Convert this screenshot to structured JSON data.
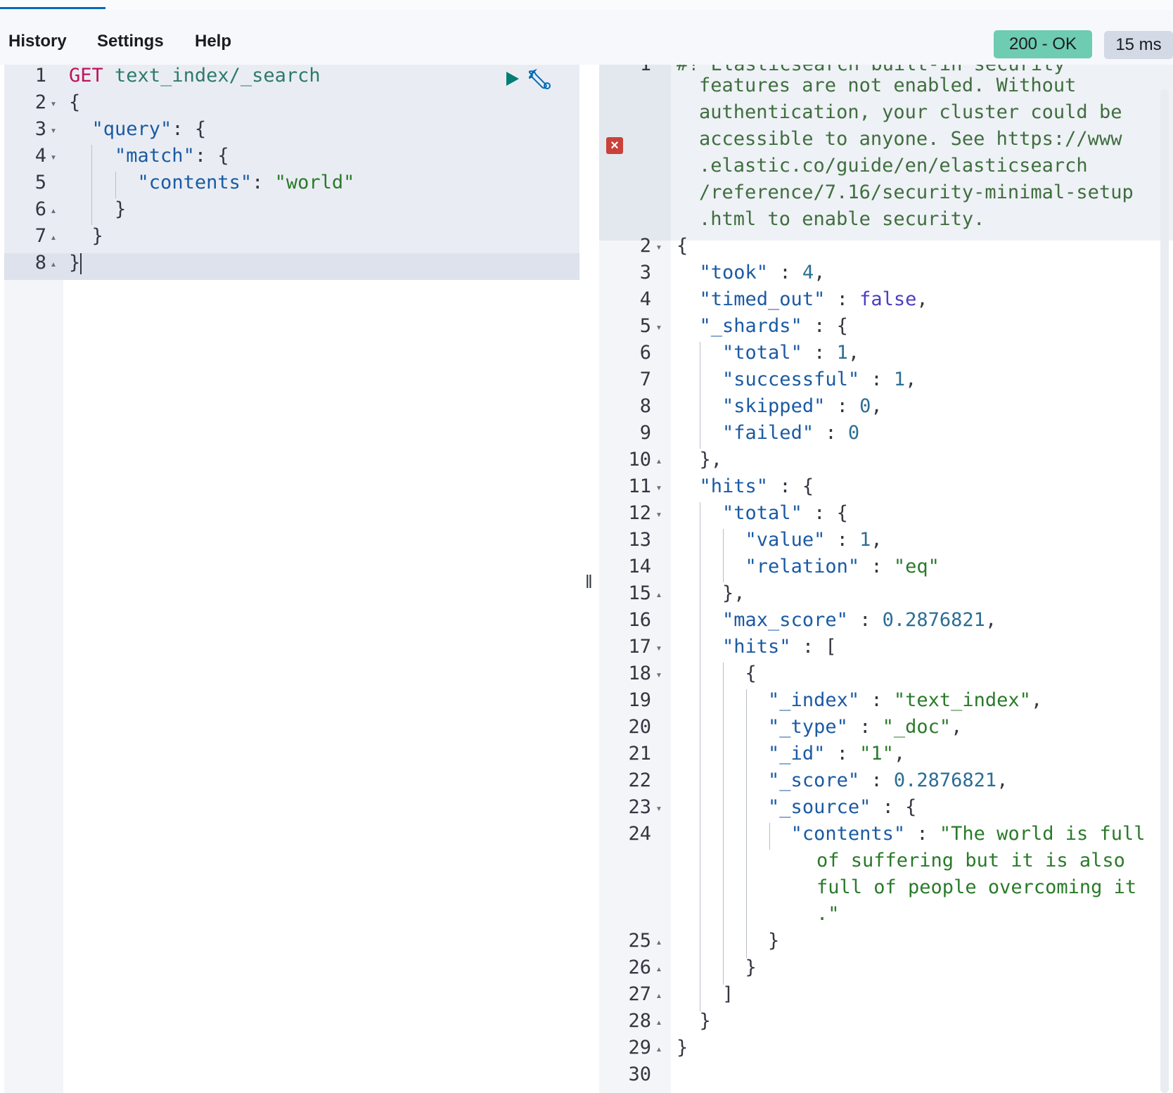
{
  "menu": {
    "history": "History",
    "settings": "Settings",
    "help": "Help"
  },
  "status": {
    "code": "200 - OK",
    "time": "15 ms"
  },
  "request": {
    "line_numbers": [
      "1",
      "2",
      "3",
      "4",
      "5",
      "6",
      "7",
      "8"
    ],
    "method": "GET",
    "path": "text_index/_search",
    "lines": {
      "l2": "{",
      "l3_key": "\"query\"",
      "l3_rest": ": {",
      "l4_key": "\"match\"",
      "l4_rest": ": {",
      "l5_key": "\"contents\"",
      "l5_colon": ": ",
      "l5_val": "\"world\"",
      "l6": "}",
      "l7": "}",
      "l8": "}"
    },
    "icons": {
      "run": "play-icon",
      "settings": "wrench-icon"
    }
  },
  "response": {
    "warning_lines": [
      "#! Elasticsearch built-in security",
      "features are not enabled. Without",
      "authentication, your cluster could be",
      "accessible to anyone. See https://www",
      ".elastic.co/guide/en/elasticsearch",
      "/reference/7.16/security-minimal-setup",
      ".html to enable security."
    ],
    "line_numbers": [
      "1",
      "2",
      "3",
      "4",
      "5",
      "6",
      "7",
      "8",
      "9",
      "10",
      "11",
      "12",
      "13",
      "14",
      "15",
      "16",
      "17",
      "18",
      "19",
      "20",
      "21",
      "22",
      "23",
      "24",
      "25",
      "26",
      "27",
      "28",
      "29",
      "30"
    ],
    "json": {
      "took_key": "\"took\"",
      "took_val": "4",
      "timed_out_key": "\"timed_out\"",
      "timed_out_val": "false",
      "shards_key": "\"_shards\"",
      "total_key": "\"total\"",
      "total_val": "1",
      "successful_key": "\"successful\"",
      "successful_val": "1",
      "skipped_key": "\"skipped\"",
      "skipped_val": "0",
      "failed_key": "\"failed\"",
      "failed_val": "0",
      "hits_key": "\"hits\"",
      "hits_total_key": "\"total\"",
      "value_key": "\"value\"",
      "value_val": "1",
      "relation_key": "\"relation\"",
      "relation_val": "\"eq\"",
      "max_score_key": "\"max_score\"",
      "max_score_val": "0.2876821",
      "hits_arr_key": "\"hits\"",
      "index_key": "\"_index\"",
      "index_val": "\"text_index\"",
      "type_key": "\"_type\"",
      "type_val": "\"_doc\"",
      "id_key": "\"_id\"",
      "id_val": "\"1\"",
      "score_key": "\"_score\"",
      "score_val": "0.2876821",
      "source_key": "\"_source\"",
      "contents_key": "\"contents\"",
      "contents_val_1": "\"The world is full",
      "contents_val_2": "of suffering but it is also",
      "contents_val_3": "full of people overcoming it",
      "contents_val_4": ".\""
    }
  }
}
